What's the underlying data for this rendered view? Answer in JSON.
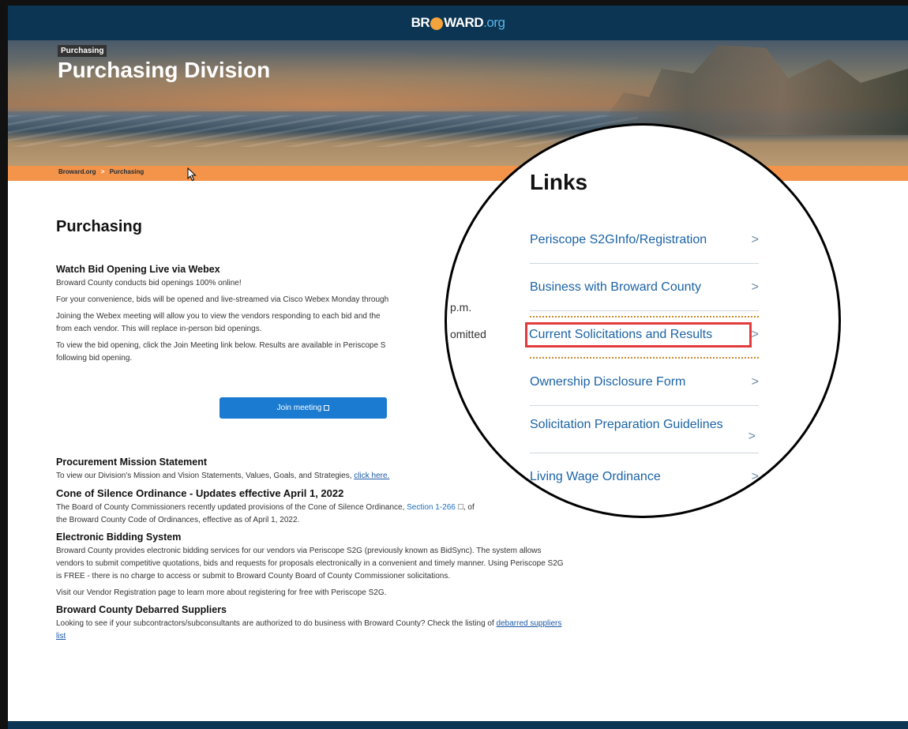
{
  "header": {
    "logo_main": "BR",
    "logo_rest": "WARD",
    "logo_org": ".org"
  },
  "hero": {
    "kicker": "Purchasing",
    "title": "Purchasing Division"
  },
  "breadcrumb": {
    "home": "Broward.org",
    "separator": ">",
    "current": "Purchasing"
  },
  "page": {
    "heading": "Purchasing"
  },
  "webex": {
    "title": "Watch Bid Opening Live via Webex",
    "p1": "Broward County conducts bid openings 100% online!",
    "p2": "For your convenience, bids will be opened and live-streamed via Cisco Webex Monday through",
    "p3a": "Joining the Webex meeting will allow you to view the vendors responding to each bid and the",
    "p3b": "from each vendor.  This will replace in-person bid openings.",
    "p4a": "To view the bid opening, click the Join Meeting link below. Results are available in Periscope S",
    "p4b": "following bid opening.",
    "button": "Join meeting"
  },
  "mission": {
    "title": "Procurement Mission Statement",
    "text": "To view our Division's Mission and Vision Statements, Values, Goals, and Strategies,",
    "link": "click here."
  },
  "cone": {
    "title": "Cone of Silence Ordinance - Updates effective April 1, 2022",
    "text_a": "The Board of County Commissioners recently updated provisions of the Cone of Silence Ordinance,",
    "link": "Section 1-266",
    "text_b": ", of",
    "text_c": "the Broward County Code of Ordinances, effective as of April 1, 2022."
  },
  "ebid": {
    "title": "Electronic Bidding System",
    "p1": "Broward County provides electronic bidding services for our vendors via Periscope S2G (previously known as BidSync). The system allows vendors to submit competitive quotations, bids and requests for proposals electronically in a convenient and timely manner. Using Periscope S2G is FREE - there is no charge to access or submit to Broward County Board of County Commissioner solicitations.",
    "p2": "Visit our Vendor Registration page to learn more about registering for free with Periscope S2G."
  },
  "debarred": {
    "title": "Broward County Debarred Suppliers",
    "text_a": "Looking to see if your subcontractors/subconsultants are authorized to do business with Broward County?  Check the listing of",
    "link": "debarred suppliers list"
  },
  "magnifier": {
    "peek_1": "p.m.",
    "peek_2": "omitted",
    "title": "Links",
    "items": [
      {
        "label": "Periscope S2GInfo/Registration"
      },
      {
        "label": "Business with Broward County"
      },
      {
        "label": "Current Solicitations and Results"
      },
      {
        "label": "Ownership Disclosure Form"
      },
      {
        "label": "Solicitation Preparation Guidelines"
      },
      {
        "label": "Living Wage Ordinance"
      }
    ],
    "chevron": ">"
  },
  "colors": {
    "topbar": "#0b3552",
    "breadcrumb_bar": "#f4944a",
    "button": "#1a7bd0",
    "link": "#1b63a6",
    "highlight": "#e23b3b"
  }
}
